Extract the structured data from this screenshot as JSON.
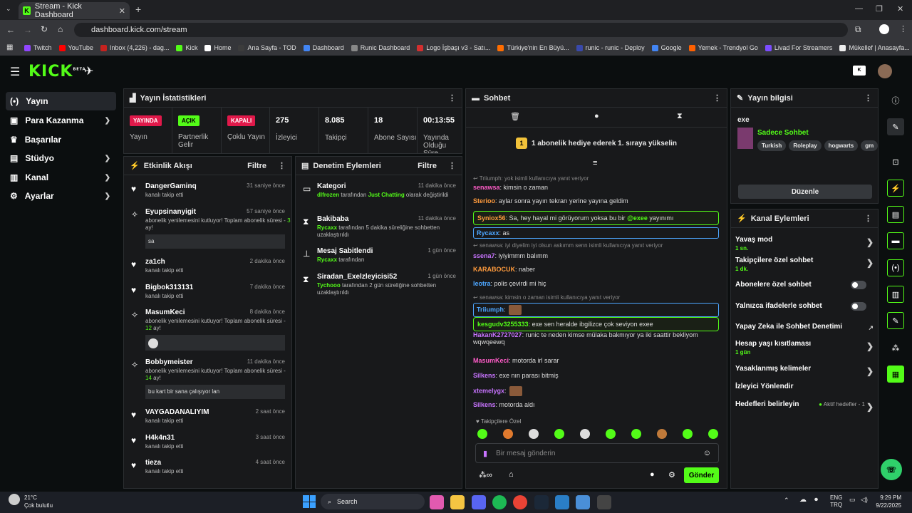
{
  "browser": {
    "tab_title": "Stream - Kick Dashboard",
    "url": "dashboard.kick.com/stream",
    "bookmarks": [
      "Twitch",
      "YouTube",
      "Inbox (4,226) - dag...",
      "Kick",
      "Home",
      "Ana Sayfa - TOD",
      "Dashboard",
      "Runic Dashboard",
      "Logo İşbaşı v3 - Satı...",
      "Türkiye'nin En Büyü...",
      "runic - runic - Deploy",
      "Google",
      "Yemek - Trendyol Go",
      "Livad For Streamers",
      "Mükellef | Anasayfa..."
    ]
  },
  "app": {
    "logo": "KICK",
    "logo_sup": "BETA"
  },
  "sidebar": {
    "items": [
      {
        "label": "Yayın"
      },
      {
        "label": "Para Kazanma"
      },
      {
        "label": "Başarılar"
      },
      {
        "label": "Stüdyo"
      },
      {
        "label": "Kanal"
      },
      {
        "label": "Ayarlar"
      }
    ]
  },
  "stats": {
    "title": "Yayın İstatistikleri",
    "cells": [
      {
        "badge": "YAYINDA",
        "label": "Yayın"
      },
      {
        "badge": "AÇIK",
        "label": "Partnerlik Gelir"
      },
      {
        "badge": "KAPALI",
        "label": "Çoklu Yayın"
      },
      {
        "value": "275",
        "label": "İzleyici"
      },
      {
        "value": "8.085",
        "label": "Takipçi"
      },
      {
        "value": "18",
        "label": "Abone Sayısı"
      },
      {
        "value": "00:13:55",
        "label": "Yayında Olduğu Süre"
      }
    ]
  },
  "activity": {
    "title": "Etkinlik Akışı",
    "filter": "Filtre",
    "items": [
      {
        "name": "DangerGaminq",
        "time": "31 saniye önce",
        "sub": "kanalı takip etti"
      },
      {
        "name": "Eyupsinanyigit",
        "time": "57 saniye önce",
        "sub_a": "abonelik yenilemesini kutluyor! Toplam abonelik süresi - ",
        "months": "3",
        "sub_b": " ay!",
        "msg": "sa"
      },
      {
        "name": "za1ch",
        "time": "2 dakika önce",
        "sub": "kanalı takip etti"
      },
      {
        "name": "Bigbok313131",
        "time": "7 dakika önce",
        "sub": "kanalı takip etti"
      },
      {
        "name": "MasumKeci",
        "time": "8 dakika önce",
        "sub_a": "abonelik yenilemesini kutluyor! Toplam abonelik süresi - ",
        "months": "12",
        "sub_b": " ay!"
      },
      {
        "name": "Bobbymeister",
        "time": "11 dakika önce",
        "sub_a": "abonelik yenilemesini kutluyor! Toplam abonelik süresi - ",
        "months": "14",
        "sub_b": " ay!",
        "msg": "bu kart bir sana çalışıyor lan"
      },
      {
        "name": "VAYGADANALIYIM",
        "time": "2 saat önce",
        "sub": "kanalı takip etti"
      },
      {
        "name": "H4k4n31",
        "time": "3 saat önce",
        "sub": "kanalı takip etti"
      },
      {
        "name": "tieza",
        "time": "4 saat önce",
        "sub": "kanalı takip etti"
      }
    ]
  },
  "moderation": {
    "title": "Denetim Eylemleri",
    "filter": "Filtre",
    "items": [
      {
        "name": "Kategori",
        "time": "11 dakika önce",
        "user": "dlfrozen",
        "text_a": " tarafından ",
        "target": "Just Chatting",
        "text_b": " olarak değiştirildi"
      },
      {
        "name": "Bakibaba",
        "time": "11 dakika önce",
        "user": "Rycaxx",
        "text_a": " tarafından 5 dakika süreliğine sohbetten uzaklaştırıldı"
      },
      {
        "name": "Mesaj Sabitlendi",
        "time": "1 gün önce",
        "user": "Rycaxx",
        "text_a": " tarafından"
      },
      {
        "name": "Siradan_Exelzleyicisi52",
        "time": "1 gün önce",
        "user": "Tychooo",
        "text_a": " tarafından 2 gün süreliğine sohbetten uzaklaştırıldı"
      }
    ]
  },
  "chat": {
    "title": "Sohbet",
    "gift_banner": "1 abonelik hediye ederek 1. sıraya yükselin",
    "gift_num": "1",
    "lines": [
      {
        "reply": "Triiumph: yok isimli kullanıcıya yanıt veriyor"
      },
      {
        "user": "senawsa",
        "text": ": kimsin o zaman",
        "color": "#ff5cc8"
      },
      {
        "user": "Sterioo",
        "text": ": aylar sonra yayın tekrarı yerine yayına geldim",
        "color": "#ff9b3d"
      },
      {
        "user": "Syniox56",
        "text": ": Sa, hey hayal mi görüyorum yoksa bu bir ",
        "mention": "@exee",
        "text2": " yayınımı",
        "color": "#ff9b3d",
        "hl": true
      },
      {
        "user": "Rycaxx",
        "text": ": as",
        "color": "#4da6ff",
        "box": true
      },
      {
        "reply": "senawsa: iyi diyelim iyi olsun askımm senn isimli kullanıcıya yanıt veriyor"
      },
      {
        "user": "ssena7",
        "text": ": iyiyimmm balımm",
        "color": "#c874ff"
      },
      {
        "user": "KARABOCUK",
        "text": ": naber",
        "color": "#ff9b3d"
      },
      {
        "user": "leotra",
        "text": ": polis çevirdi mi hiç",
        "color": "#4da6ff"
      },
      {
        "reply": "senawsa: kimsin o zaman isimli kullanıcıya yanıt veriyor"
      },
      {
        "user": "Triiumph",
        "text": ":",
        "color": "#4da6ff",
        "box": true
      },
      {
        "user": "kesgudv3255333",
        "text": ": exe sen heralde ibgilizce çok seviyon exee",
        "color": "#53fc18",
        "hl": true
      },
      {
        "user": "HakanK2727027",
        "text": ": runic te neden kimse mülaka bakmıyor ya iki saattir bekliyom wqwqeewq",
        "color": "#c874ff"
      },
      {
        "user": "MasumKeci",
        "text": ": motorda irl sarar",
        "color": "#ff5cc8"
      },
      {
        "user": "Silkens",
        "text": ": exe nın parası bitmiş",
        "color": "#c874ff"
      },
      {
        "user": "xtemelygx",
        "text": ":",
        "color": "#c874ff"
      },
      {
        "user": "Silkens",
        "text": ": motorda aldı",
        "color": "#c874ff"
      }
    ],
    "followers_only": "Takipçilere Özel",
    "placeholder": "Bir mesaj gönderin",
    "send": "Gönder"
  },
  "stream_info": {
    "title": "Yayın bilgisi",
    "stream_title": "exe",
    "category": "Sadece Sohbet",
    "tags": [
      "Turkish",
      "Roleplay",
      "hogwarts",
      "gm"
    ],
    "edit": "Düzenle"
  },
  "channel_actions": {
    "title": "Kanal Eylemleri",
    "items": [
      {
        "label": "Yavaş mod",
        "sub": "1 sn."
      },
      {
        "label": "Takipçilere özel sohbet",
        "sub": "1 dk."
      },
      {
        "label": "Abonelere özel sohbet"
      },
      {
        "label": "Yalnızca ifadelerle sohbet"
      },
      {
        "label": "Yapay Zeka ile Sohbet Denetimi"
      },
      {
        "label": "Hesap yaşı kısıtlaması",
        "sub": "1 gün"
      },
      {
        "label": "Yasaklanmış kelimeler"
      },
      {
        "label": "İzleyici Yönlendir"
      },
      {
        "label": "Hedefleri belirleyin",
        "status": "Aktif hedefler - 1"
      }
    ]
  },
  "taskbar": {
    "weather_temp": "21°C",
    "weather_desc": "Çok bulutlu",
    "search": "Search",
    "lang": "ENG",
    "lang2": "TRQ",
    "time": "9:29 PM",
    "date": "9/22/2025"
  }
}
